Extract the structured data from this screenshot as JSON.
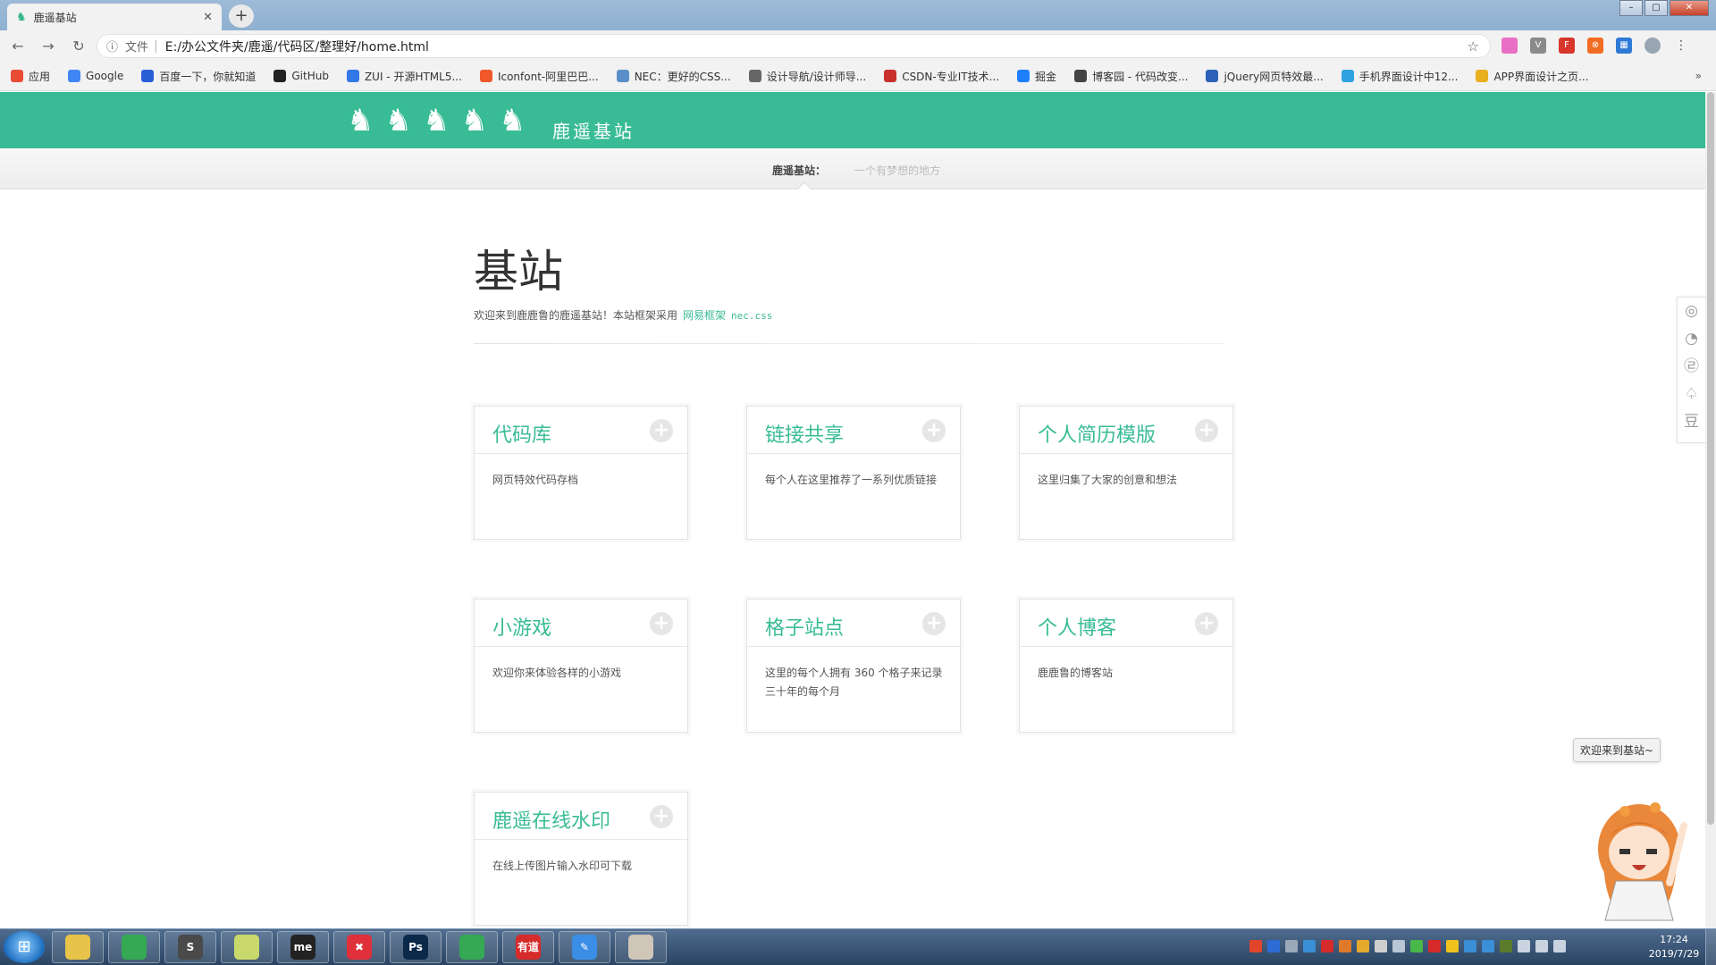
{
  "browser": {
    "tab_title": "鹿遥基站",
    "tab_icon": "deer-icon",
    "new_tab": "+",
    "address_scheme": "文件",
    "address_url": "E:/办公文件夹/鹿遥/代码区/整理好/home.html"
  },
  "bookmarks": [
    {
      "label": "应用",
      "icon": "apps-grid-icon",
      "color": "#e94b35"
    },
    {
      "label": "Google",
      "icon": "google-icon",
      "color": "#4285f4"
    },
    {
      "label": "百度一下，你就知道",
      "icon": "baidu-paw-icon",
      "color": "#2b5fd8"
    },
    {
      "label": "GitHub",
      "icon": "github-icon",
      "color": "#222222"
    },
    {
      "label": "ZUI - 开源HTML5...",
      "icon": "zui-icon",
      "color": "#3278e6"
    },
    {
      "label": "Iconfont-阿里巴巴...",
      "icon": "iconfont-icon",
      "color": "#f0572a"
    },
    {
      "label": "NEC：更好的CSS...",
      "icon": "nec-icon",
      "color": "#5b8fc9"
    },
    {
      "label": "设计导航/设计师导...",
      "icon": "design-nav-icon",
      "color": "#666666"
    },
    {
      "label": "CSDN-专业IT技术...",
      "icon": "csdn-icon",
      "color": "#c9302c"
    },
    {
      "label": "掘金",
      "icon": "juejin-icon",
      "color": "#1e80ff"
    },
    {
      "label": "博客园 - 代码改变...",
      "icon": "cnblogs-icon",
      "color": "#444444"
    },
    {
      "label": "jQuery网页特效最...",
      "icon": "jquery-icon",
      "color": "#2b62b8"
    },
    {
      "label": "手机界面设计中12...",
      "icon": "telegram-icon",
      "color": "#2fa3e0"
    },
    {
      "label": "APP界面设计之页...",
      "icon": "app-design-icon",
      "color": "#e8b020"
    }
  ],
  "site": {
    "name": "鹿遥基站",
    "subnav_label": "鹿遥基站：",
    "motto": "一个有梦想的地方",
    "page_title": "基站",
    "intro_text": "欢迎来到鹿鹿鲁的鹿遥基站！本站框架采用",
    "intro_link": "网易框架",
    "intro_code": "nec.css"
  },
  "cards": [
    {
      "title": "代码库",
      "desc": "网页特效代码存档"
    },
    {
      "title": "链接共享",
      "desc": "每个人在这里推荐了一系列优质链接"
    },
    {
      "title": "个人简历模版",
      "desc": "这里归集了大家的创意和想法"
    },
    {
      "title": "小游戏",
      "desc": "欢迎你来体验各样的小游戏"
    },
    {
      "title": "格子站点",
      "desc": "这里的每个人拥有 360 个格子来记录三十年的每个月"
    },
    {
      "title": "个人博客",
      "desc": "鹿鹿鲁的博客站"
    },
    {
      "title": "鹿遥在线水印",
      "desc": "在线上传图片输入水印可下载"
    }
  ],
  "share_icons": [
    "wechat-icon",
    "weibo-icon",
    "qzone-icon",
    "tencent-weibo-icon",
    "douban-icon"
  ],
  "share_glyphs": [
    "◎",
    "◔",
    "㉣",
    "♤",
    "豆"
  ],
  "tooltip": "欢迎来到基站~",
  "taskbar": {
    "apps": [
      {
        "icon": "file-explorer-icon",
        "label": "",
        "color": "#e7c34a"
      },
      {
        "icon": "chrome-icon",
        "label": "",
        "color": "#34a853"
      },
      {
        "icon": "sublime-text-icon",
        "label": "S",
        "color": "#4a4a4a"
      },
      {
        "icon": "folder-icon",
        "label": "",
        "color": "#c8d86a"
      },
      {
        "icon": "mindmaster-icon",
        "label": "me",
        "color": "#222222"
      },
      {
        "icon": "xmind-icon",
        "label": "✖",
        "color": "#e0303a"
      },
      {
        "icon": "photoshop-icon",
        "label": "Ps",
        "color": "#0b2a4a"
      },
      {
        "icon": "chrome-icon",
        "label": "",
        "color": "#34a853"
      },
      {
        "icon": "youdao-icon",
        "label": "有道",
        "color": "#d62b2b"
      },
      {
        "icon": "note-icon",
        "label": "✎",
        "color": "#3a8ee6"
      },
      {
        "icon": "image-viewer-icon",
        "label": "",
        "color": "#cfc6b8"
      }
    ],
    "time": "17:24",
    "date": "2019/7/29"
  }
}
